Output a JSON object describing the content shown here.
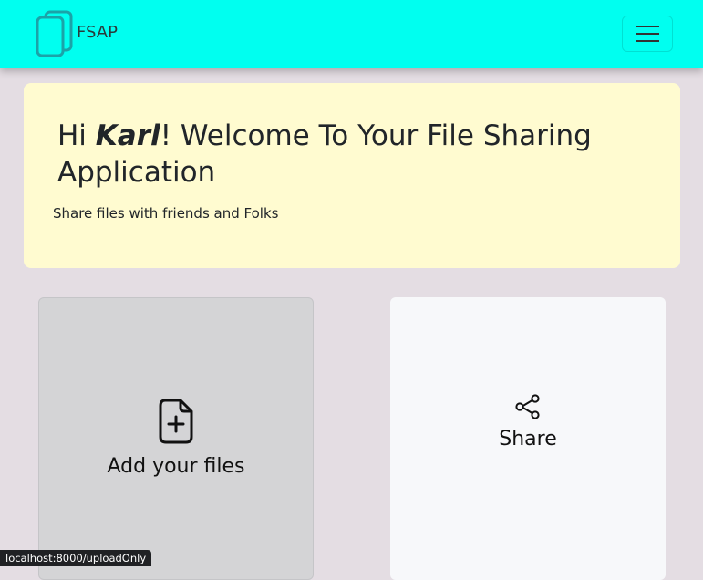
{
  "navbar": {
    "brand": "FSAP",
    "toggler_icon": "hamburger-menu-icon",
    "logo_icon": "stacked-files-icon",
    "background": "#00fff0"
  },
  "hero": {
    "greeting_prefix": "Hi ",
    "username": "Karl",
    "greeting_suffix": "! Welcome To Your File Sharing Application",
    "subtitle": "Share files with friends and Folks",
    "background": "#fffbd0"
  },
  "cards": {
    "add": {
      "label": "Add your files",
      "icon": "file-plus-icon"
    },
    "share": {
      "label": "Share",
      "icon": "share-icon"
    }
  },
  "status_bar": {
    "url": "localhost:8000/uploadOnly"
  }
}
